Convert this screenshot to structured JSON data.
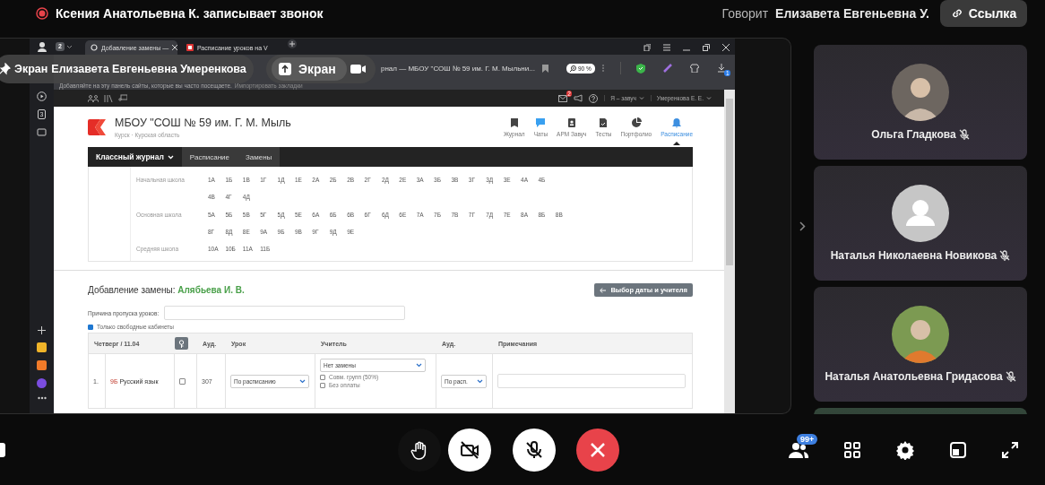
{
  "call_header": {
    "recording_text": "Ксения Анатольевна К. записывает звонок",
    "speaker_label": "Говорит",
    "speaker_name": "Елизавета Евгеньевна У.",
    "link_button": "Ссылка"
  },
  "screen_share": {
    "presenter_pill": {
      "label": "Экран",
      "name": "Елизавета Евгеньевна Умеренкова"
    },
    "screen_button": "Экран",
    "browser": {
      "tab_count": "2",
      "tabs": [
        {
          "title": "Добавление замены —",
          "selected": true
        },
        {
          "title": "Расписание уроков на V",
          "selected": false
        }
      ],
      "address": "рнал — МБОУ \"СОШ № 59 им. Г. М. Мыльни...",
      "zoom": "90 %",
      "downloads_badge": "1",
      "sidebar_badge": "3",
      "bookmarks_hint": "Добавляйте на эту панель сайты, которые вы часто посещаете.",
      "bookmarks_link": "Импортировать закладки",
      "site": {
        "mail_badge": "2",
        "role": "Я – завуч",
        "user": "Умеренкова Е. Е.",
        "school_name": "МБОУ \"СОШ № 59 им. Г. М. Мыль",
        "location": "Курск · Курская область",
        "nav": [
          {
            "label": "Журнал",
            "kind": "journal",
            "selected": false
          },
          {
            "label": "Чаты",
            "kind": "chat",
            "selected": false
          },
          {
            "label": "АРМ Завуч",
            "kind": "badge",
            "selected": false
          },
          {
            "label": "Тесты",
            "kind": "test",
            "selected": false
          },
          {
            "label": "Портфолио",
            "kind": "portfolio",
            "selected": false
          },
          {
            "label": "Расписание",
            "kind": "bell",
            "selected": true
          }
        ],
        "menu": [
          {
            "label": "Классный журнал",
            "selected": true,
            "dropdown": true
          },
          {
            "label": "Расписание",
            "selected": false,
            "dropdown": false
          },
          {
            "label": "Замены",
            "selected": false,
            "dropdown": false
          }
        ],
        "schools": [
          {
            "label": "Начальная школа",
            "rows": [
              [
                "1А",
                "1Б",
                "1В",
                "1Г",
                "1Д",
                "1Е",
                "2А",
                "2Б",
                "2В",
                "2Г",
                "2Д",
                "2Е",
                "3А",
                "3Б",
                "3В",
                "3Г",
                "3Д",
                "3Е",
                "4А",
                "4Б"
              ],
              [
                "4В",
                "4Г",
                "4Д"
              ]
            ]
          },
          {
            "label": "Основная школа",
            "rows": [
              [
                "5А",
                "5Б",
                "5В",
                "5Г",
                "5Д",
                "5Е",
                "6А",
                "6Б",
                "6В",
                "6Г",
                "6Д",
                "6Е",
                "7А",
                "7Б",
                "7В",
                "7Г",
                "7Д",
                "7Е",
                "8А",
                "8Б",
                "8В"
              ],
              [
                "8Г",
                "8Д",
                "8Е",
                "9А",
                "9Б",
                "9В",
                "9Г",
                "9Д",
                "9Е"
              ]
            ]
          },
          {
            "label": "Средняя школа",
            "rows": [
              [
                "10А",
                "10Б",
                "11А",
                "11Б"
              ]
            ]
          }
        ],
        "form": {
          "title": "Добавление замены:",
          "teacher": "Алябьева И. В.",
          "back_button": "Выбор даты и учителя",
          "reason_label": "Причина пропуска уроков:",
          "free_rooms": {
            "label": "Только свободные кабинеты",
            "checked": true
          },
          "columns": [
            "Четверг / 11.04",
            "Ауд.",
            "Урок",
            "Учитель",
            "Ауд.",
            "Примечания"
          ],
          "rows": [
            {
              "number": "1.",
              "class": "9Б",
              "subject": "Русский язык",
              "checked": false,
              "room": "307",
              "lesson": "По расписанию",
              "teacher": "Нет замены",
              "options": [
                {
                  "label": "Совм. групп (50%)",
                  "checked": false
                },
                {
                  "label": "Без оплаты",
                  "checked": false
                }
              ],
              "room_select": "По расп."
            }
          ]
        }
      }
    }
  },
  "participants": [
    {
      "name": "Ольга Гладкова",
      "kind": "photo",
      "muted": true
    },
    {
      "name": "Наталья Николаевна Новикова",
      "kind": "placeholder",
      "muted": true
    },
    {
      "name": "Наталья Анатольевна Гридасова",
      "kind": "photo",
      "muted": true
    }
  ],
  "controls": [
    {
      "kind": "raise-hand"
    },
    {
      "kind": "camera-off"
    },
    {
      "kind": "mic-off"
    },
    {
      "kind": "hang-up"
    }
  ],
  "tools": [
    {
      "kind": "participants",
      "badge": "99+"
    },
    {
      "kind": "grid"
    },
    {
      "kind": "settings"
    },
    {
      "kind": "layout"
    },
    {
      "kind": "fullscreen"
    }
  ]
}
